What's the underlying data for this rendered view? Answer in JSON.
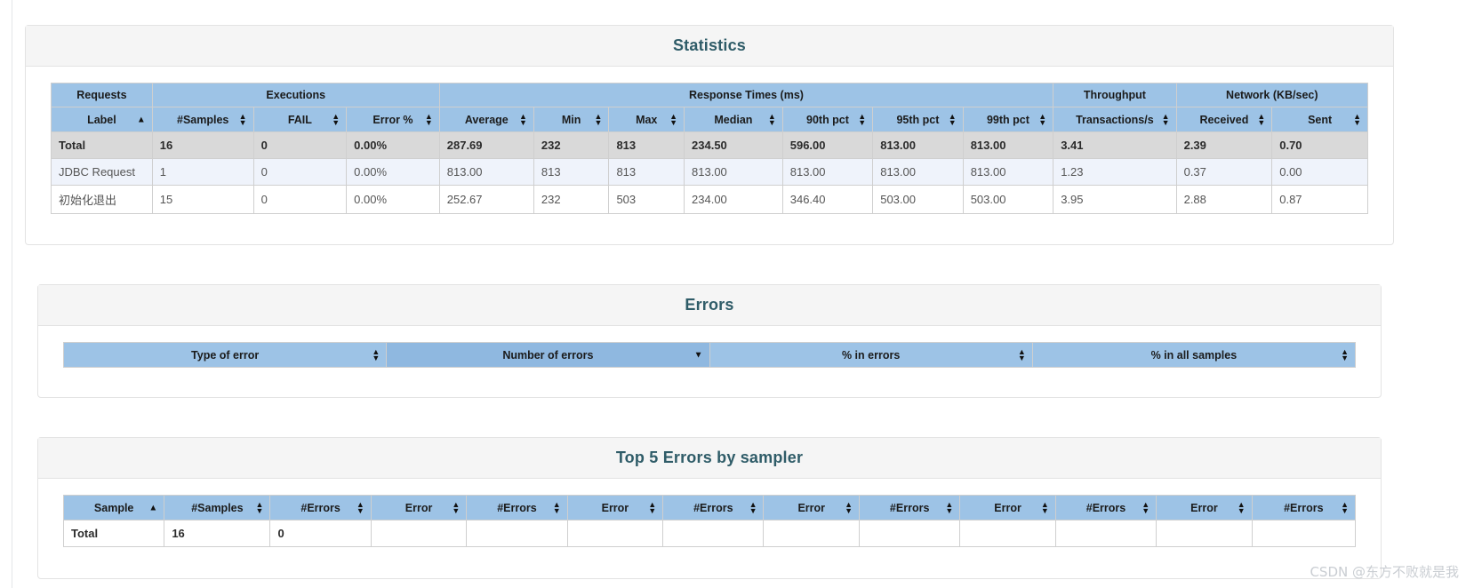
{
  "panels": {
    "statistics": {
      "title": "Statistics",
      "group_headers": [
        {
          "label": "Requests",
          "span": 1
        },
        {
          "label": "Executions",
          "span": 3
        },
        {
          "label": "Response Times (ms)",
          "span": 7
        },
        {
          "label": "Throughput",
          "span": 1
        },
        {
          "label": "Network (KB/sec)",
          "span": 2
        }
      ],
      "columns": [
        {
          "label": "Label",
          "sort": "asc"
        },
        {
          "label": "#Samples",
          "sort": "both"
        },
        {
          "label": "FAIL",
          "sort": "both"
        },
        {
          "label": "Error %",
          "sort": "both"
        },
        {
          "label": "Average",
          "sort": "both"
        },
        {
          "label": "Min",
          "sort": "both"
        },
        {
          "label": "Max",
          "sort": "both"
        },
        {
          "label": "Median",
          "sort": "both"
        },
        {
          "label": "90th pct",
          "sort": "both"
        },
        {
          "label": "95th pct",
          "sort": "both"
        },
        {
          "label": "99th pct",
          "sort": "both"
        },
        {
          "label": "Transactions/s",
          "sort": "both"
        },
        {
          "label": "Received",
          "sort": "both"
        },
        {
          "label": "Sent",
          "sort": "both"
        }
      ],
      "rows": [
        {
          "type": "total",
          "cells": [
            "Total",
            "16",
            "0",
            "0.00%",
            "287.69",
            "232",
            "813",
            "234.50",
            "596.00",
            "813.00",
            "813.00",
            "3.41",
            "2.39",
            "0.70"
          ]
        },
        {
          "type": "odd",
          "cells": [
            "JDBC Request",
            "1",
            "0",
            "0.00%",
            "813.00",
            "813",
            "813",
            "813.00",
            "813.00",
            "813.00",
            "813.00",
            "1.23",
            "0.37",
            "0.00"
          ]
        },
        {
          "type": "even",
          "cells": [
            "初始化退出",
            "15",
            "0",
            "0.00%",
            "252.67",
            "232",
            "503",
            "234.00",
            "346.40",
            "503.00",
            "503.00",
            "3.95",
            "2.88",
            "0.87"
          ]
        }
      ]
    },
    "errors": {
      "title": "Errors",
      "columns": [
        {
          "label": "Type of error",
          "sort": "both",
          "sorted": false
        },
        {
          "label": "Number of errors",
          "sort": "desc",
          "sorted": true
        },
        {
          "label": "% in errors",
          "sort": "both",
          "sorted": false
        },
        {
          "label": "% in all samples",
          "sort": "both",
          "sorted": false
        }
      ],
      "rows": []
    },
    "top5": {
      "title": "Top 5 Errors by sampler",
      "columns": [
        {
          "label": "Sample",
          "sort": "asc"
        },
        {
          "label": "#Samples",
          "sort": "both"
        },
        {
          "label": "#Errors",
          "sort": "both"
        },
        {
          "label": "Error",
          "sort": "both"
        },
        {
          "label": "#Errors",
          "sort": "both"
        },
        {
          "label": "Error",
          "sort": "both"
        },
        {
          "label": "#Errors",
          "sort": "both"
        },
        {
          "label": "Error",
          "sort": "both"
        },
        {
          "label": "#Errors",
          "sort": "both"
        },
        {
          "label": "Error",
          "sort": "both"
        },
        {
          "label": "#Errors",
          "sort": "both"
        },
        {
          "label": "Error",
          "sort": "both"
        },
        {
          "label": "#Errors",
          "sort": "both"
        }
      ],
      "rows": [
        {
          "type": "total-plain",
          "cells": [
            "Total",
            "16",
            "0",
            "",
            "",
            "",
            "",
            "",
            "",
            "",
            "",
            "",
            ""
          ]
        }
      ]
    }
  },
  "watermark": "CSDN @东方不败就是我"
}
